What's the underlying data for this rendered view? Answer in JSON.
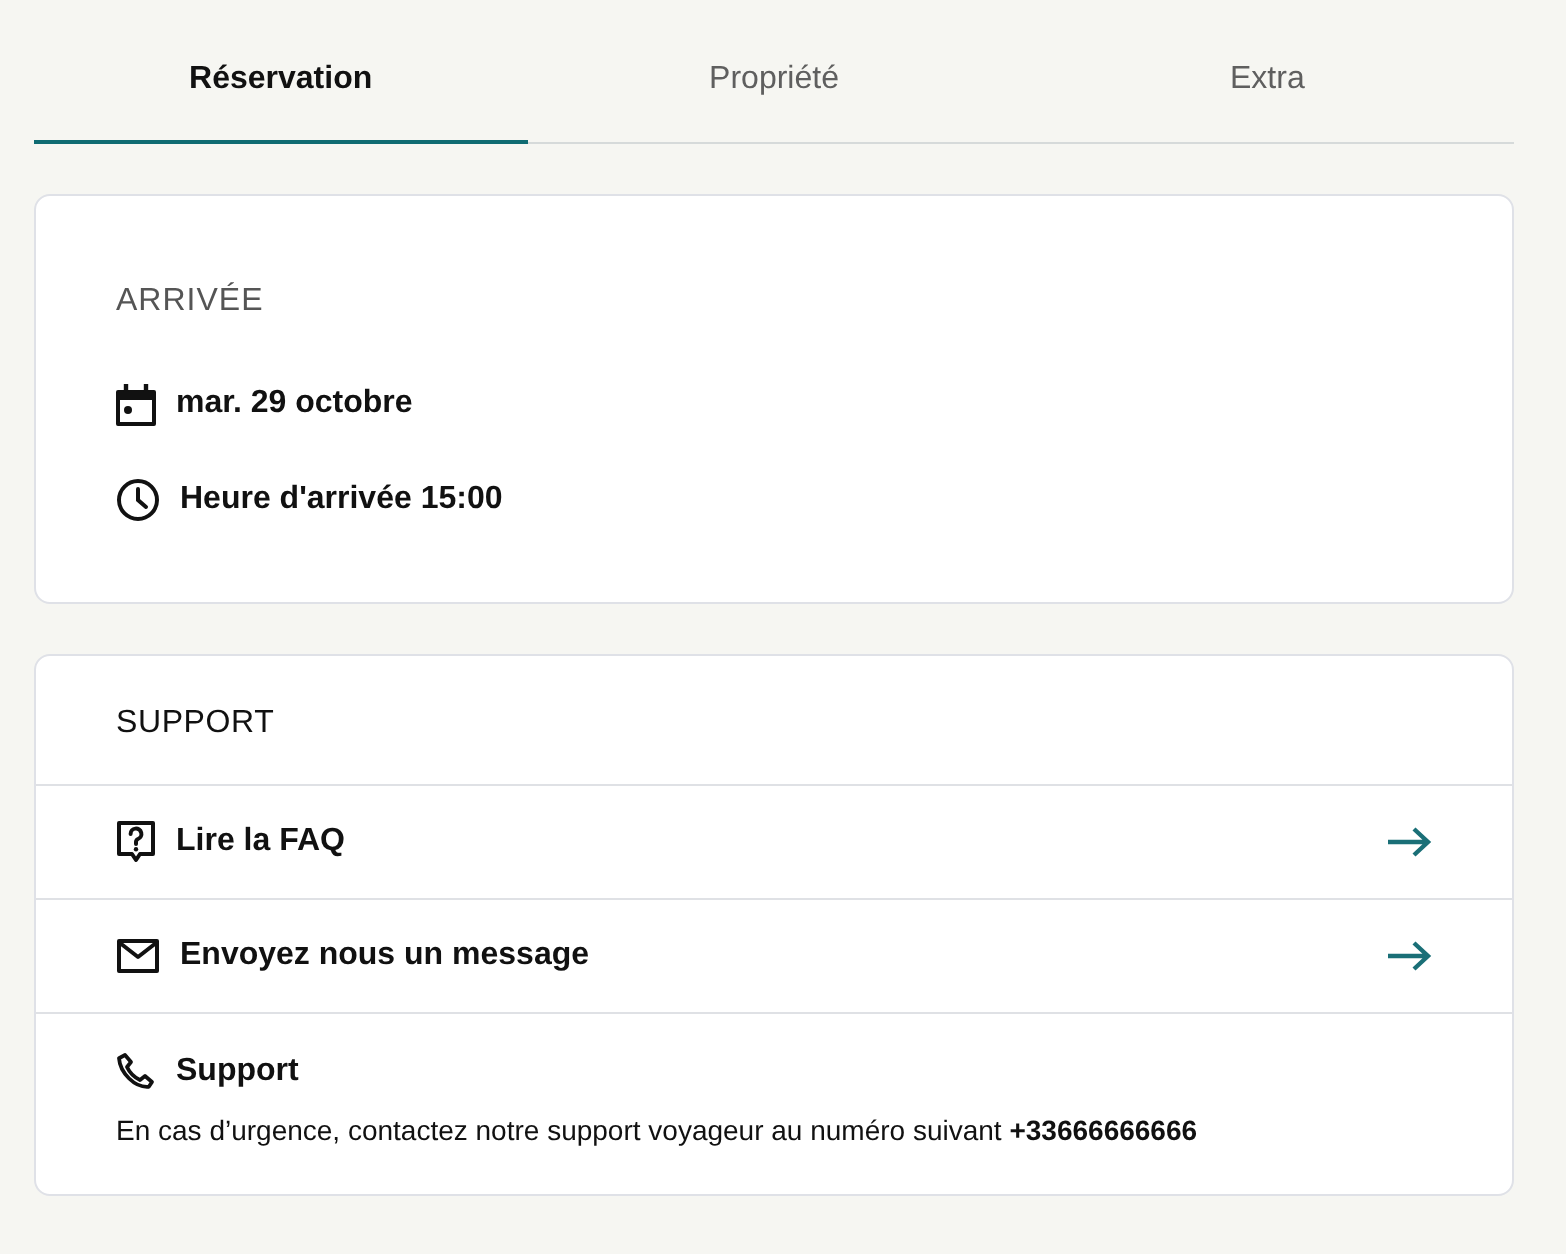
{
  "tabs": [
    {
      "label": "Réservation",
      "selected": true
    },
    {
      "label": "Propriété",
      "selected": false
    },
    {
      "label": "Extra",
      "selected": false
    }
  ],
  "arrival": {
    "title": "ARRIVÉE",
    "items": [
      {
        "kind": "date",
        "text": "mar. 29 octobre"
      },
      {
        "kind": "time",
        "text": "Heure d'arrivée 15:00"
      }
    ]
  },
  "support": {
    "title": "SUPPORT",
    "links": [
      {
        "kind": "faq",
        "label": "Lire la FAQ"
      },
      {
        "kind": "message",
        "label": "Envoyez nous un message"
      }
    ],
    "contact": {
      "kind": "phone",
      "title": "Support",
      "text": "En cas d’urgence, contactez notre support voyageur au numéro suivant **+33666666666**"
    }
  }
}
